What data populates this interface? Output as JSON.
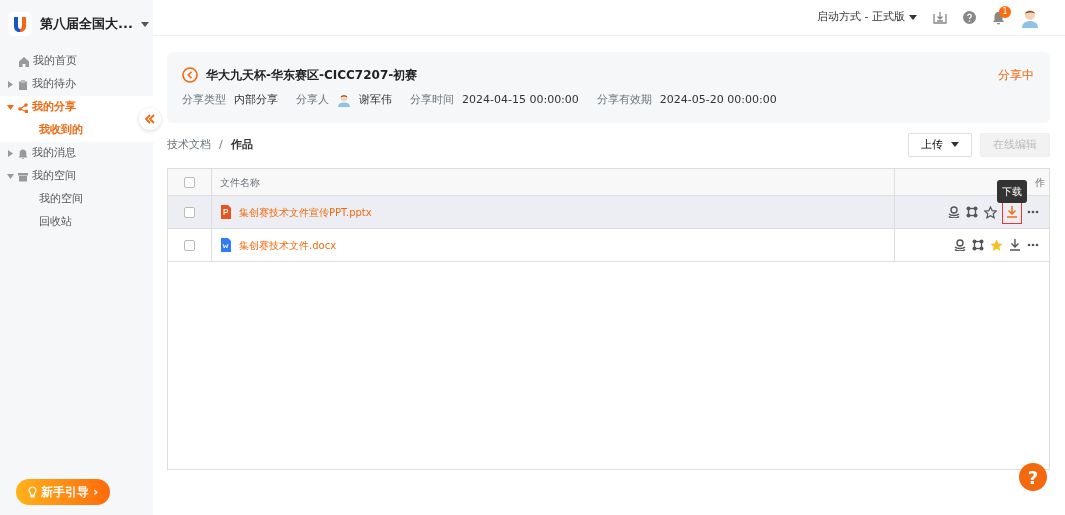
{
  "app": {
    "title": "第八届全国大..."
  },
  "sidebar": {
    "items": [
      {
        "label": "我的首页",
        "selected": false
      },
      {
        "label": "我的待办",
        "expanded": false,
        "selected": false
      },
      {
        "label": "我的分享",
        "expanded": true,
        "selected": true,
        "children": [
          {
            "label": "我收到的",
            "selected": true
          }
        ]
      },
      {
        "label": "我的消息",
        "expanded": false,
        "selected": false
      },
      {
        "label": "我的空间",
        "expanded": true,
        "selected": false,
        "children": [
          {
            "label": "我的空间",
            "selected": false
          },
          {
            "label": "回收站",
            "selected": false
          }
        ]
      }
    ]
  },
  "guide_button": {
    "label": "新手引导",
    "arrow": "›"
  },
  "topbar": {
    "mode": "启动方式 - 正式版",
    "notifications": "1"
  },
  "share": {
    "title": "华大九天杯-华东赛区-CICC7207-初赛",
    "status": "分享中",
    "fields": [
      {
        "label": "分享类型",
        "value": "内部分享",
        "kind": "text"
      },
      {
        "label": "分享人",
        "value": "谢军伟",
        "kind": "person"
      },
      {
        "label": "分享时间",
        "value": "2024-04-15 00:00:00",
        "kind": "text"
      },
      {
        "label": "分享有效期",
        "value": "2024-05-20 00:00:00",
        "kind": "text"
      }
    ]
  },
  "breadcrumb": {
    "items": [
      "技术文档",
      "作品"
    ],
    "separator": "/"
  },
  "toolbar": {
    "upload": "上传",
    "edit_online": "在线编辑",
    "edit_disabled": true
  },
  "table": {
    "columns": [
      "文件名称",
      "作"
    ],
    "all_checked": false,
    "rows": [
      {
        "name": "集创赛技术文件宣传PPT.pptx",
        "kind": "presentation",
        "checked": false,
        "highlighted": true,
        "starred": false,
        "download_focused": true
      },
      {
        "name": "集创赛技术文件.docx",
        "kind": "document",
        "checked": false,
        "highlighted": false,
        "starred": true,
        "download_focused": false
      }
    ]
  },
  "tooltip": {
    "text": "下载"
  },
  "help": {
    "label": "?"
  }
}
